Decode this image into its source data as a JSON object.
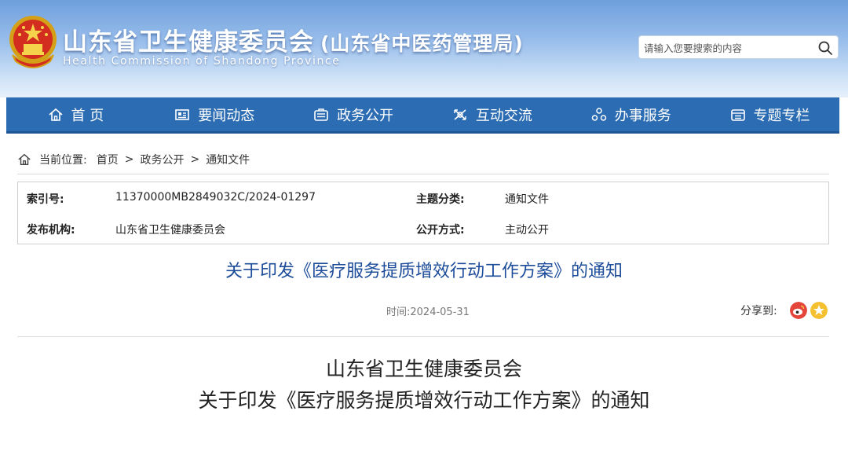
{
  "header": {
    "title": "山东省卫生健康委员会",
    "title_sub": "(山东省中医药管理局)",
    "title_en": "Health Commission  of  Shandong  Province",
    "emblem_icon": "national-emblem-icon"
  },
  "search": {
    "placeholder": "请输入您要搜索的内容",
    "icon": "search-icon"
  },
  "nav": {
    "items": [
      {
        "label": "首 页",
        "icon": "home-icon"
      },
      {
        "label": "要闻动态",
        "icon": "news-icon"
      },
      {
        "label": "政务公开",
        "icon": "document-icon"
      },
      {
        "label": "互动交流",
        "icon": "interaction-icon"
      },
      {
        "label": "办事服务",
        "icon": "service-icon"
      },
      {
        "label": "专题专栏",
        "icon": "topic-icon"
      }
    ],
    "bg_color": "#2c6cb2"
  },
  "breadcrumb": {
    "prefix": "当前位置:",
    "items": [
      "首页",
      "政务公开",
      "通知文件"
    ],
    "separator": ">"
  },
  "meta": {
    "index_label": "索引号:",
    "index_value": "11370000MB2849032C/2024-01297",
    "topic_label": "主题分类:",
    "topic_value": "通知文件",
    "publisher_label": "发布机构:",
    "publisher_value": "山东省卫生健康委员会",
    "disclosure_label": "公开方式:",
    "disclosure_value": "主动公开"
  },
  "article": {
    "title": "关于印发《医疗服务提质增效行动工作方案》的通知",
    "time_label": "时间:",
    "time_value": "2024-05-31",
    "share_label": "分享到:",
    "share_icons": [
      "weibo-icon",
      "qzone-icon"
    ],
    "body_heading_line1": "山东省卫生健康委员会",
    "body_heading_line2": "关于印发《医疗服务提质增效行动工作方案》的通知",
    "title_color": "#1d4c9a"
  }
}
